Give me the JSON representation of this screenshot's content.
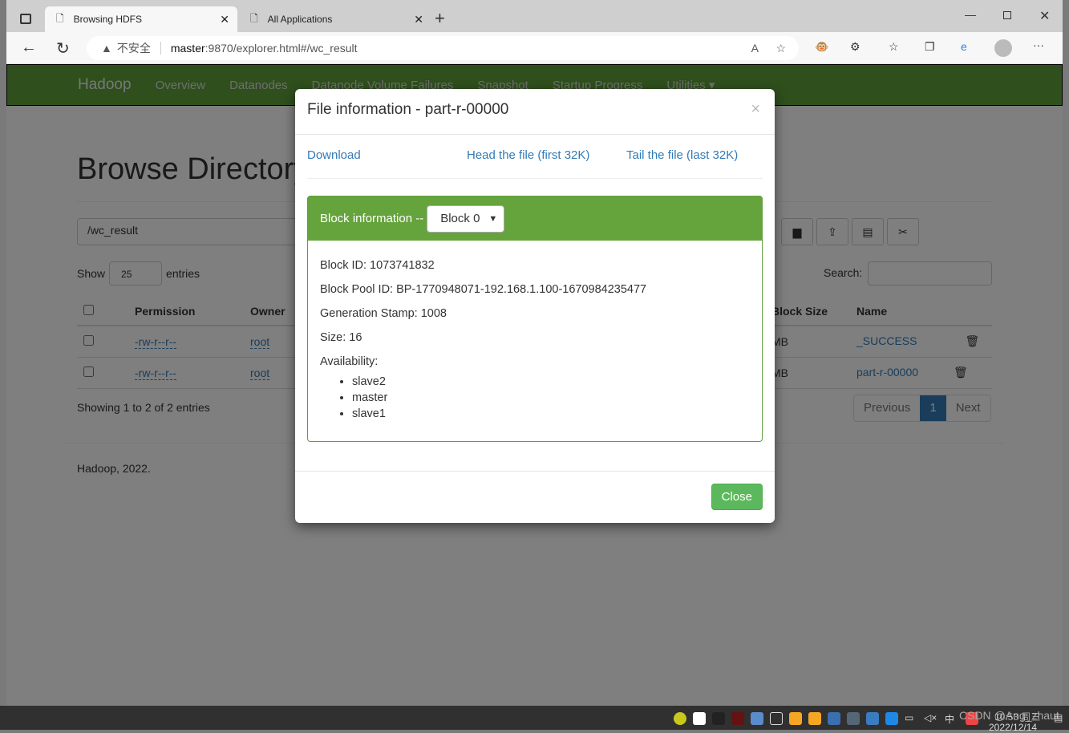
{
  "browser": {
    "tabs": [
      {
        "title": "Browsing HDFS",
        "active": true
      },
      {
        "title": "All Applications",
        "active": false
      }
    ],
    "security": "不安全",
    "url_host": "master",
    "url_rest": ":9870/explorer.html#/wc_result"
  },
  "nav": {
    "brand": "Hadoop",
    "items": [
      "Overview",
      "Datanodes",
      "Datanode Volume Failures",
      "Snapshot",
      "Startup Progress",
      "Utilities ▾"
    ]
  },
  "page": {
    "title": "Browse Directory",
    "path": "/wc_result",
    "show": "Show",
    "entries_value": "25",
    "entries": "entries",
    "search_label": "Search:",
    "columns": [
      "Permission",
      "Owner",
      "Block Size",
      "Name"
    ],
    "rows": [
      {
        "permission": "-rw-r--r--",
        "owner": "root",
        "block_size": "MB",
        "name": "_SUCCESS"
      },
      {
        "permission": "-rw-r--r--",
        "owner": "root",
        "block_size": "MB",
        "name": "part-r-00000"
      }
    ],
    "showing": "Showing 1 to 2 of 2 entries",
    "pagination": {
      "previous": "Previous",
      "current": "1",
      "next": "Next"
    },
    "footer": "Hadoop, 2022."
  },
  "modal": {
    "title": "File information - part-r-00000",
    "download": "Download",
    "head": "Head the file (first 32K)",
    "tail": "Tail the file (last 32K)",
    "block_header": "Block information --",
    "block_select": "Block 0",
    "block_id": "Block ID: 1073741832",
    "pool_id": "Block Pool ID: BP-1770948071-192.168.1.100-1670984235477",
    "gen_stamp": "Generation Stamp: 1008",
    "size": "Size: 16",
    "availability": "Availability:",
    "nodes": [
      "slave2",
      "master",
      "slave1"
    ],
    "close": "Close"
  },
  "taskbar": {
    "watermark": "CSDN @Ang_zhaut",
    "time": "10:53 周三",
    "date": "2022/12/14",
    "ime": "中"
  }
}
